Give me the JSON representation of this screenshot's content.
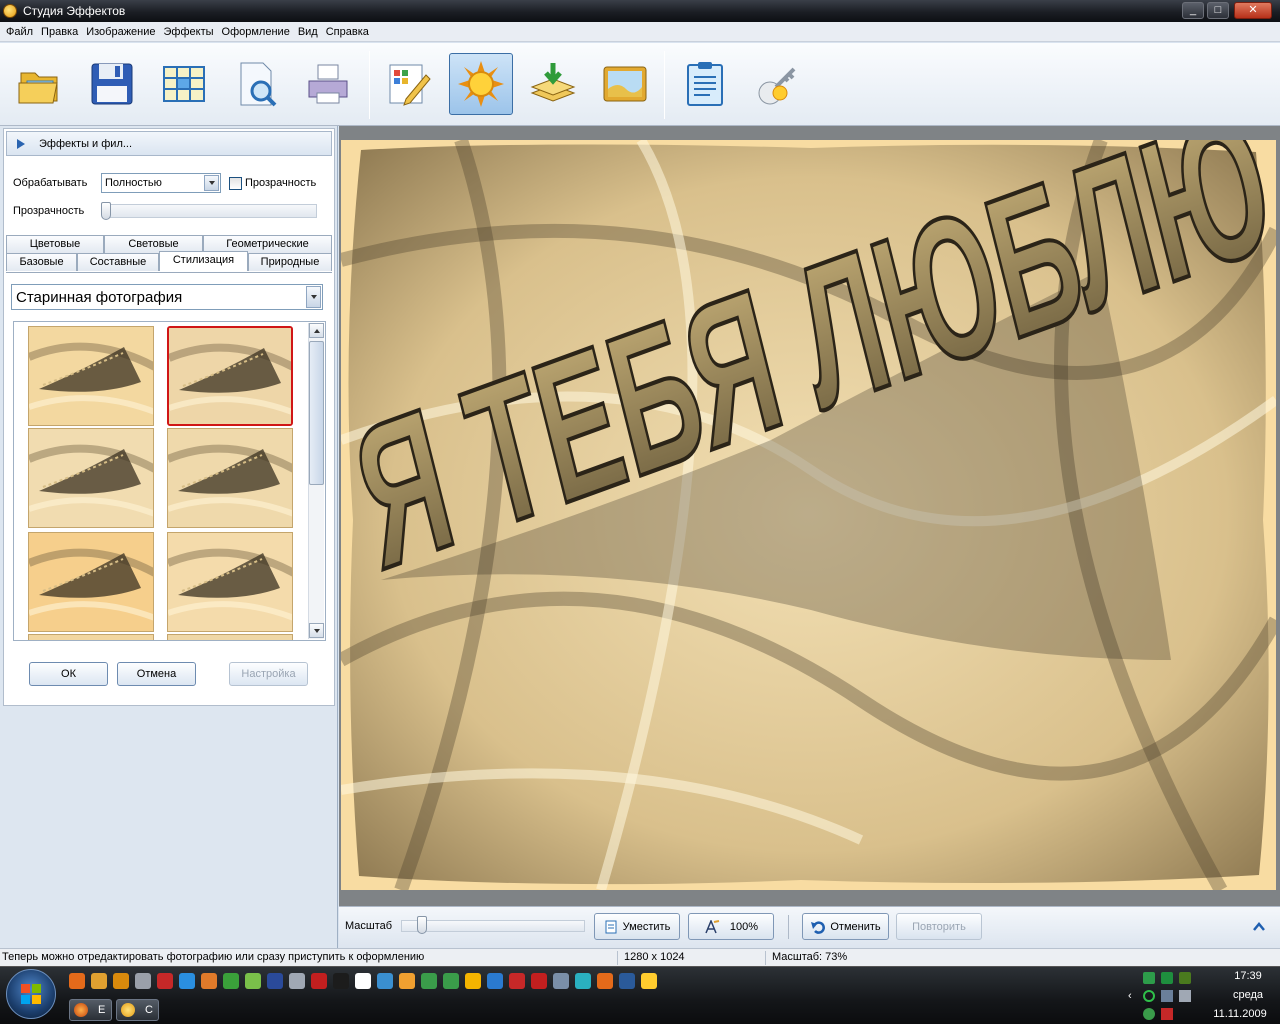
{
  "window": {
    "title": "Студия Эффектов",
    "minimize": "_",
    "maximize": "□",
    "close": "✕"
  },
  "menu": [
    "Файл",
    "Правка",
    "Изображение",
    "Эффекты",
    "Оформление",
    "Вид",
    "Справка"
  ],
  "toolbar": {
    "buttons": [
      {
        "name": "open-folder-icon"
      },
      {
        "name": "save-floppy-icon"
      },
      {
        "name": "grid-icon"
      },
      {
        "name": "preview-magnifier-icon"
      },
      {
        "name": "printer-icon"
      },
      {
        "name": "edit-pencil-icon"
      },
      {
        "name": "effects-sun-icon",
        "active": true
      },
      {
        "name": "layers-download-icon"
      },
      {
        "name": "frame-landscape-icon"
      },
      {
        "name": "clipboard-notes-icon"
      },
      {
        "name": "settings-key-icon"
      }
    ]
  },
  "panel": {
    "header": "Эффекты и фил...",
    "process_label": "Обрабатывать",
    "process_value": "Полностью",
    "transparency_checkbox": "Прозрачность",
    "transparency_slider_label": "Прозрачность",
    "transparency_level": 0,
    "tabs_row1": [
      "Цветовые",
      "Световые",
      "Геометрические"
    ],
    "tabs_row2": [
      "Базовые",
      "Составные",
      "Стилизация",
      "Природные"
    ],
    "selected_tab": "Стилизация",
    "effect_value": "Старинная фотография",
    "thumbs_selected_index": 1,
    "ok": "ОК",
    "cancel": "Отмена",
    "settings": "Настройка"
  },
  "image": {
    "text": "Я ТЕБЯ ЛЮБЛЮ"
  },
  "zoombar": {
    "label": "Масштаб",
    "fit": "Уместить",
    "zoom100": "100%",
    "undo": "Отменить",
    "redo": "Повторить"
  },
  "status": {
    "message": "Теперь можно отредактировать фотографию или сразу приступить к оформлению",
    "size": "1280 x 1024",
    "zoom": "Масштаб: 73%"
  },
  "taskbar": {
    "tasks": [
      "E",
      "C"
    ],
    "clock": "17:39",
    "day": "среда",
    "date": "11.11.2009"
  },
  "colors": {
    "accent": "#3b6ea5",
    "photo": "#f8dca2",
    "sepia_dark": "#3a3325",
    "selection": "#d01616"
  }
}
